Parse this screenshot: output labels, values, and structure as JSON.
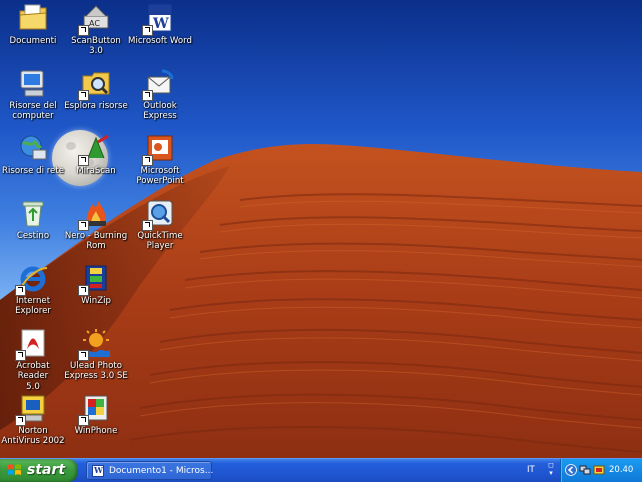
{
  "desktop": {
    "icons": [
      {
        "label": "Documenti",
        "icon": "my-documents-icon"
      },
      {
        "label": "ScanButton 3.0",
        "icon": "scanbutton-icon"
      },
      {
        "label": "Microsoft Word",
        "icon": "word-icon"
      },
      {
        "label": "Risorse del\ncomputer",
        "icon": "my-computer-icon"
      },
      {
        "label": "Esplora risorse",
        "icon": "explorer-icon"
      },
      {
        "label": "Outlook\nExpress",
        "icon": "outlook-express-icon"
      },
      {
        "label": "Risorse di rete",
        "icon": "network-places-icon"
      },
      {
        "label": "MiraScan",
        "icon": "mirascan-icon"
      },
      {
        "label": "Microsoft\nPowerPoint",
        "icon": "powerpoint-icon"
      },
      {
        "label": "Cestino",
        "icon": "recycle-bin-icon"
      },
      {
        "label": "Nero - Burning\nRom",
        "icon": "nero-icon"
      },
      {
        "label": "QuickTime\nPlayer",
        "icon": "quicktime-icon"
      },
      {
        "label": "Internet\nExplorer",
        "icon": "internet-explorer-icon"
      },
      {
        "label": "WinZip",
        "icon": "winzip-icon"
      },
      {
        "label": "Acrobat Reader\n5.0",
        "icon": "acrobat-reader-icon"
      },
      {
        "label": "Ulead Photo\nExpress 3.0 SE",
        "icon": "ulead-photo-icon"
      },
      {
        "label": "Norton\nAntiVirus 2002",
        "icon": "norton-antivirus-icon"
      },
      {
        "label": "WinPhone",
        "icon": "winphone-icon"
      }
    ]
  },
  "taskbar": {
    "start_label": "start",
    "open_window_label": "Documento1 - Micros...",
    "language": "IT",
    "clock": "20.40"
  },
  "colors": {
    "sky": "#1f57c8",
    "dune": "#b0401a",
    "taskbar": "#245edb",
    "start_button": "#3b9b3d",
    "tray": "#1386e2"
  }
}
